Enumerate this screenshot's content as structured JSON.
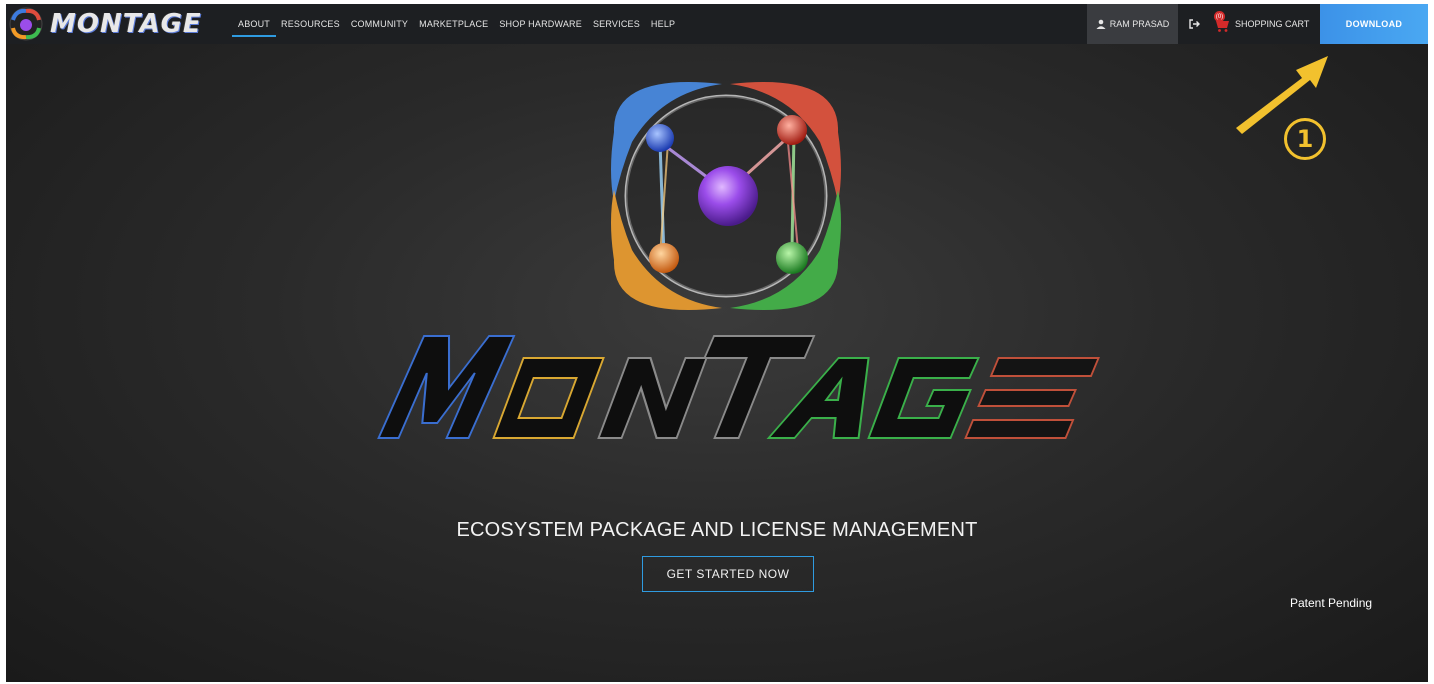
{
  "brand": {
    "name": "MONTAGE"
  },
  "nav": {
    "items": [
      {
        "label": "ABOUT",
        "active": true
      },
      {
        "label": "RESOURCES"
      },
      {
        "label": "COMMUNITY"
      },
      {
        "label": "MARKETPLACE"
      },
      {
        "label": "SHOP HARDWARE"
      },
      {
        "label": "SERVICES"
      },
      {
        "label": "HELP"
      }
    ]
  },
  "header": {
    "user_name": "RAM PRASAD",
    "cart_label": "SHOPPING CART",
    "cart_count": "(0)",
    "download_label": "DOWNLOAD",
    "icons": {
      "user": "user-icon",
      "logout": "logout-icon",
      "cart": "cart-icon"
    }
  },
  "hero": {
    "tagline": "ECOSYSTEM PACKAGE AND LICENSE MANAGEMENT",
    "cta_label": "GET STARTED NOW",
    "patent_text": "Patent Pending"
  },
  "annotation": {
    "number": "1",
    "color": "#f2c12e"
  },
  "colors": {
    "accent": "#2f9be0",
    "download_bg": "#3c92e8",
    "navbar_bg": "#1d1f22"
  }
}
